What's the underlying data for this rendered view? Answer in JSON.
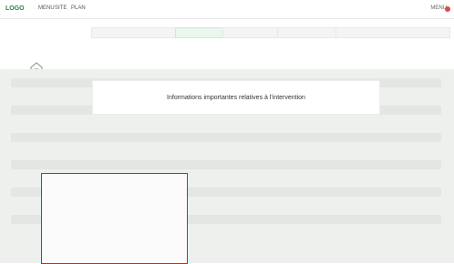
{
  "app": {
    "logo": "LOGO",
    "nav": [
      "MENU",
      "SITE",
      "PLAN"
    ],
    "right": "MENU",
    "notification": "!"
  },
  "tabs": [
    "",
    "",
    "",
    "",
    ""
  ],
  "info": {
    "left_meta": [
      "",
      "",
      "",
      ""
    ],
    "mid_meta": [
      "",
      "",
      ""
    ],
    "right_meta": [
      "",
      "",
      ""
    ]
  },
  "banner": {
    "text": "Informations importantes relatives à l'intervention"
  },
  "card": {
    "title": "",
    "rows": [
      {
        "label": "",
        "value": ""
      },
      {
        "label": "",
        "value": ""
      },
      {
        "label": "",
        "value": ""
      },
      {
        "label": "",
        "value": ""
      },
      {
        "label": "",
        "value": ""
      },
      {
        "label": "",
        "value": ""
      },
      {
        "label": "",
        "value": ""
      }
    ]
  }
}
